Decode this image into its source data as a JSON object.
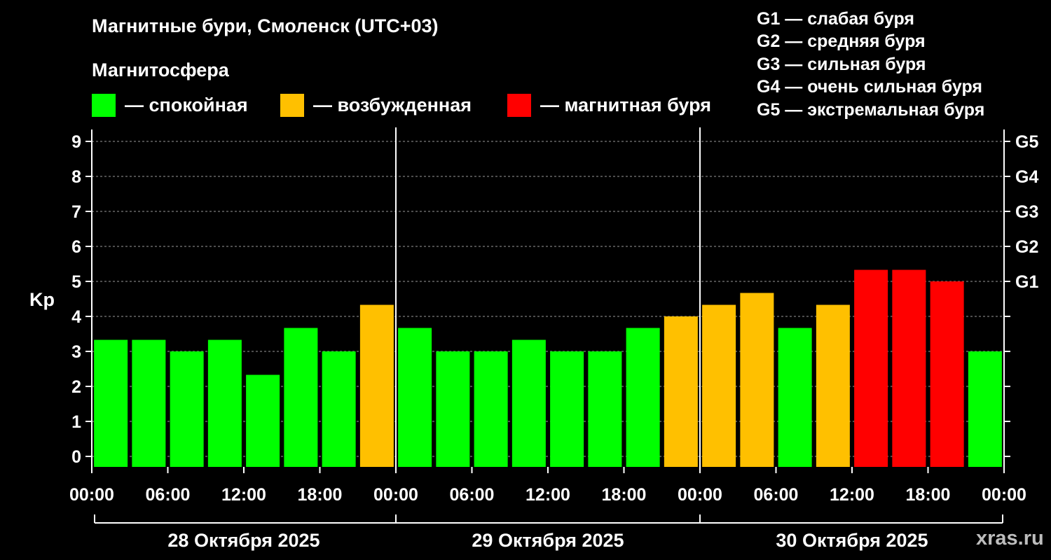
{
  "header": {
    "title": "Магнитные бури, Смоленск (UTC+03)",
    "magnetosphere_title": "Магнитосфера"
  },
  "legend": {
    "items": [
      {
        "label": "— спокойная",
        "color": "#00ff00"
      },
      {
        "label": "— возбужденная",
        "color": "#ffc000"
      },
      {
        "label": "— магнитная буря",
        "color": "#ff0000"
      }
    ],
    "g_scale": [
      "G1 — слабая буря",
      "G2 — средняя буря",
      "G3 — сильная буря",
      "G4 — очень сильная буря",
      "G5 — экстремальная буря"
    ]
  },
  "watermark": "xras.ru",
  "colors": {
    "quiet": "#00ff00",
    "active": "#ffc000",
    "storm": "#ff0000",
    "background": "#000000",
    "grid": "#9a9a9a"
  },
  "chart_data": {
    "type": "bar",
    "ylabel": "Kp",
    "ylim": [
      0,
      9
    ],
    "yticks": [
      "0",
      "1",
      "2",
      "3",
      "4",
      "5",
      "6",
      "7",
      "8",
      "9"
    ],
    "right_axis_labels": [
      {
        "value": 5,
        "label": "G1"
      },
      {
        "value": 6,
        "label": "G2"
      },
      {
        "value": 7,
        "label": "G3"
      },
      {
        "value": 8,
        "label": "G4"
      },
      {
        "value": 9,
        "label": "G5"
      }
    ],
    "grid": "horizontal dashed",
    "xtick_labels": [
      "00:00",
      "06:00",
      "12:00",
      "18:00",
      "00:00",
      "06:00",
      "12:00",
      "18:00",
      "00:00",
      "06:00",
      "12:00",
      "18:00",
      "00:00"
    ],
    "days": [
      "28 Октября 2025",
      "29 Октября 2025",
      "30 Октября 2025"
    ],
    "values": [
      3.33,
      3.33,
      3.0,
      3.33,
      2.33,
      3.67,
      3.0,
      4.33,
      3.67,
      3.0,
      3.0,
      3.33,
      3.0,
      3.0,
      3.67,
      4.0,
      4.33,
      4.67,
      3.67,
      4.33,
      5.33,
      5.33,
      5.0,
      3.0
    ],
    "levels": [
      "quiet",
      "quiet",
      "quiet",
      "quiet",
      "quiet",
      "quiet",
      "quiet",
      "active",
      "quiet",
      "quiet",
      "quiet",
      "quiet",
      "quiet",
      "quiet",
      "quiet",
      "active",
      "active",
      "active",
      "quiet",
      "active",
      "storm",
      "storm",
      "storm",
      "quiet"
    ]
  }
}
